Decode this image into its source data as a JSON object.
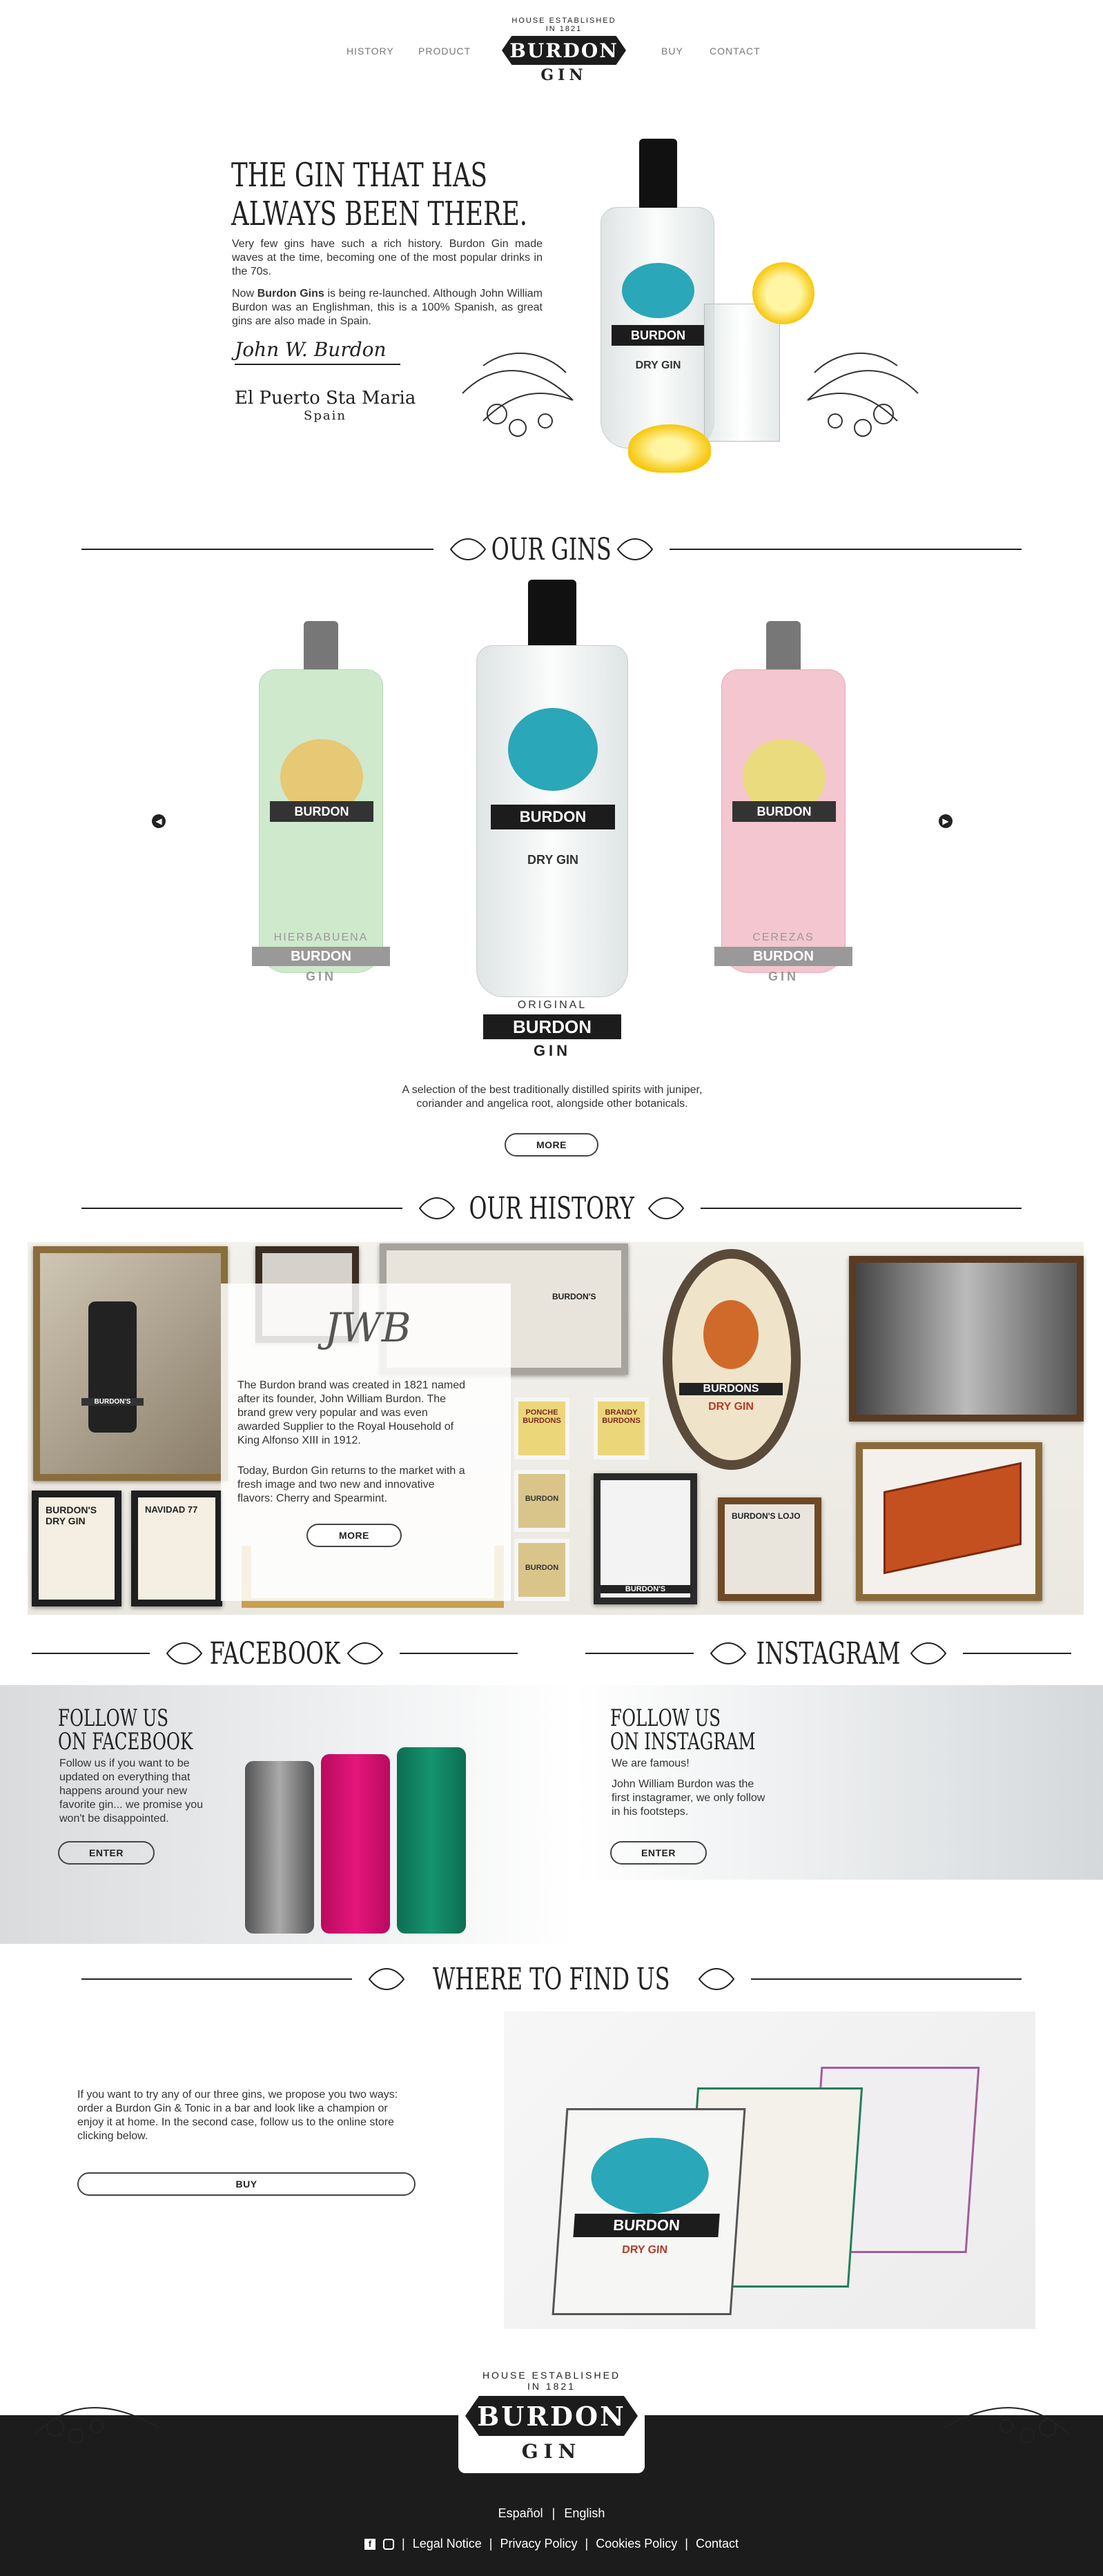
{
  "nav": {
    "left": [
      "HISTORY",
      "PRODUCT"
    ],
    "right": [
      "BUY",
      "CONTACT"
    ],
    "logo_top": "HOUSE ESTABLISHED",
    "logo_year": "IN 1821",
    "logo_name": "BURDON",
    "logo_sub": "GIN"
  },
  "hero": {
    "title_line1": "THE GIN THAT HAS",
    "title_line2": "ALWAYS BEEN THERE.",
    "para1": "Very few gins have such a rich history. Burdon Gin made waves at the time, becoming one of the most popular drinks in the 70s.",
    "para2_pre": "Now ",
    "para2_bold": "Burdon Gins",
    "para2_post": " is being re-launched. Although John William Burdon was an Englishman, this is a 100% Spanish, as great gins are also made in Spain.",
    "signature": "John W. Burdon",
    "place_line1": "El Puerto Sta Maria",
    "place_line2": "Spain"
  },
  "our_gins": {
    "title": "OUR GINS",
    "bottles": [
      {
        "label": "HIERBABUENA",
        "brand": "BURDON",
        "sub": "GIN",
        "color": "#cfe9cd"
      },
      {
        "label": "ORIGINAL",
        "brand": "BURDON",
        "sub": "GIN",
        "color": "#eef1f1"
      },
      {
        "label": "CEREZAS",
        "brand": "BURDON",
        "sub": "GIN",
        "color": "#f4c6cf"
      }
    ],
    "bottle_label": "BURDON",
    "dry_gin": "DRY GIN",
    "description": "A selection of the best traditionally distilled spirits with juniper, coriander and angelica root, alongside other botanicals.",
    "more": "MORE"
  },
  "history": {
    "title": "OUR HISTORY",
    "monogram": "JWB",
    "para1": "The Burdon brand was created in 1821 named after its founder, John William Burdon. The brand grew very popular and was even awarded Supplier to the Royal Household of King Alfonso XIII in 1912.",
    "para2": "Today, Burdon Gin returns to the market with a fresh image and two new and innovative flavors: Cherry and Spearmint.",
    "more": "MORE",
    "frame_texts": [
      "BURDON'S",
      "BURDON'S DRY GIN",
      "NAVIDAD 77",
      "BURDONS",
      "DRY GIN",
      "PONCHE BURDONS",
      "BRANDY BURDONS",
      "BURDON",
      "BURDON",
      "BURDON'S",
      "BURDON'S LOJO"
    ]
  },
  "facebook": {
    "title": "FACEBOOK",
    "heading1": "FOLLOW US",
    "heading2": "ON FACEBOOK",
    "text": "Follow us if you want to be updated on everything that happens around your new favorite gin... we promise you won't be disappointed.",
    "button": "ENTER"
  },
  "instagram": {
    "title": "INSTAGRAM",
    "heading1": "FOLLOW US",
    "heading2": "ON INSTAGRAM",
    "text1": "We are famous!",
    "text2": "John William Burdon was the first instagramer, we only follow in his footsteps.",
    "button": "ENTER"
  },
  "where": {
    "title": "WHERE TO FIND US",
    "text": "If you want to try any of our three gins, we propose you two ways: order a Burdon Gin & Tonic in a bar and look like a champion or enjoy it at home. In the second case, follow us to the online store clicking below.",
    "button": "BUY",
    "box_brand": "BURDON",
    "box_sub": "DRY GIN"
  },
  "footer": {
    "logo_top": "HOUSE ESTABLISHED",
    "logo_year": "IN 1821",
    "logo_name": "BURDON",
    "logo_sub": "GIN",
    "lang1": "Español",
    "lang2": "English",
    "links": [
      "Legal Notice",
      "Privacy Policy",
      "Cookies Policy",
      "Contact"
    ]
  },
  "colors": {
    "dark": "#1d1c1d",
    "accent_teal": "#2aa7b8",
    "pink": "#e5157b",
    "green": "#16946f"
  }
}
